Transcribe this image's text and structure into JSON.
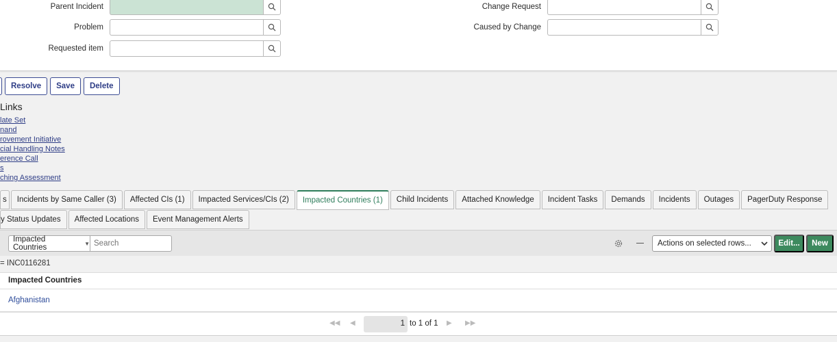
{
  "form": {
    "parent_incident_label": "Parent Incident",
    "problem_label": "Problem",
    "requested_item_label": "Requested item",
    "change_request_label": "Change Request",
    "caused_by_change_label": "Caused by Change"
  },
  "actions": {
    "resolve": "Resolve",
    "save": "Save",
    "delete": "Delete"
  },
  "related_links": {
    "title": "Links",
    "items": [
      "late Set",
      "nand",
      "rovement Initiative",
      "cial Handling Notes",
      "erence Call",
      "s",
      "ching Assessment"
    ]
  },
  "tabs_row1": [
    "s",
    "Incidents by Same Caller (3)",
    "Affected CIs (1)",
    "Impacted Services/CIs (2)",
    "Impacted Countries (1)",
    "Child Incidents",
    "Attached Knowledge",
    "Incident Tasks",
    "Demands",
    "Incidents",
    "Outages",
    "PagerDuty Response"
  ],
  "tabs_row2": [
    "y Status Updates",
    "Affected Locations",
    "Event Management Alerts"
  ],
  "list": {
    "select_value": "Impacted Countries",
    "search_placeholder": "Search",
    "actions_select": "Actions on selected rows...",
    "edit_button": "Edit...",
    "new_button": "New",
    "filter": "= INC0116281",
    "column_header": "Impacted Countries",
    "rows": [
      "Afghanistan"
    ]
  },
  "pager": {
    "page": "1",
    "range": "to 1 of 1"
  },
  "colors": {
    "brand_blue": "#2e3d86",
    "active_green": "#2e7d5b",
    "button_green": "#3d8a5e",
    "mandatory_field_bg": "#cbe3d4"
  }
}
